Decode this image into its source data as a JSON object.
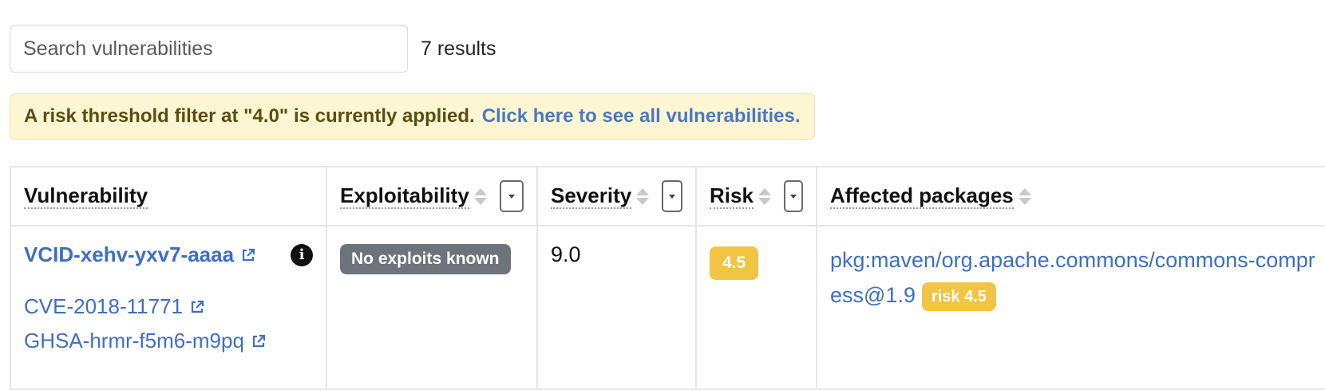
{
  "search": {
    "placeholder": "Search vulnerabilities",
    "value": ""
  },
  "result_count": "7 results",
  "notice": {
    "text": "A risk threshold filter at \"4.0\" is currently applied.",
    "link_label": "Click here to see all vulnerabilities."
  },
  "table": {
    "headers": {
      "vulnerability": "Vulnerability",
      "exploitability": "Exploitability",
      "severity": "Severity",
      "risk": "Risk",
      "affected_packages": "Affected packages"
    },
    "rows": [
      {
        "vcid": "VCID-xehv-yxv7-aaaa",
        "aliases": [
          "CVE-2018-11771",
          "GHSA-hrmr-f5m6-m9pq"
        ],
        "exploitability": "No exploits known",
        "severity": "9.0",
        "risk": "4.5",
        "package": "pkg:maven/org.apache.commons/commons-compress@1.9",
        "package_risk": "risk 4.5"
      }
    ]
  },
  "icons": {
    "external_link": "external-link-icon",
    "info": "info-icon",
    "sort": "sort-icon",
    "filter": "chevron-down-icon"
  },
  "colors": {
    "link": "#3e6fc0",
    "notice_bg": "#fef6d3",
    "risk_badge": "#f2c443",
    "exploit_badge": "#6e737a"
  }
}
